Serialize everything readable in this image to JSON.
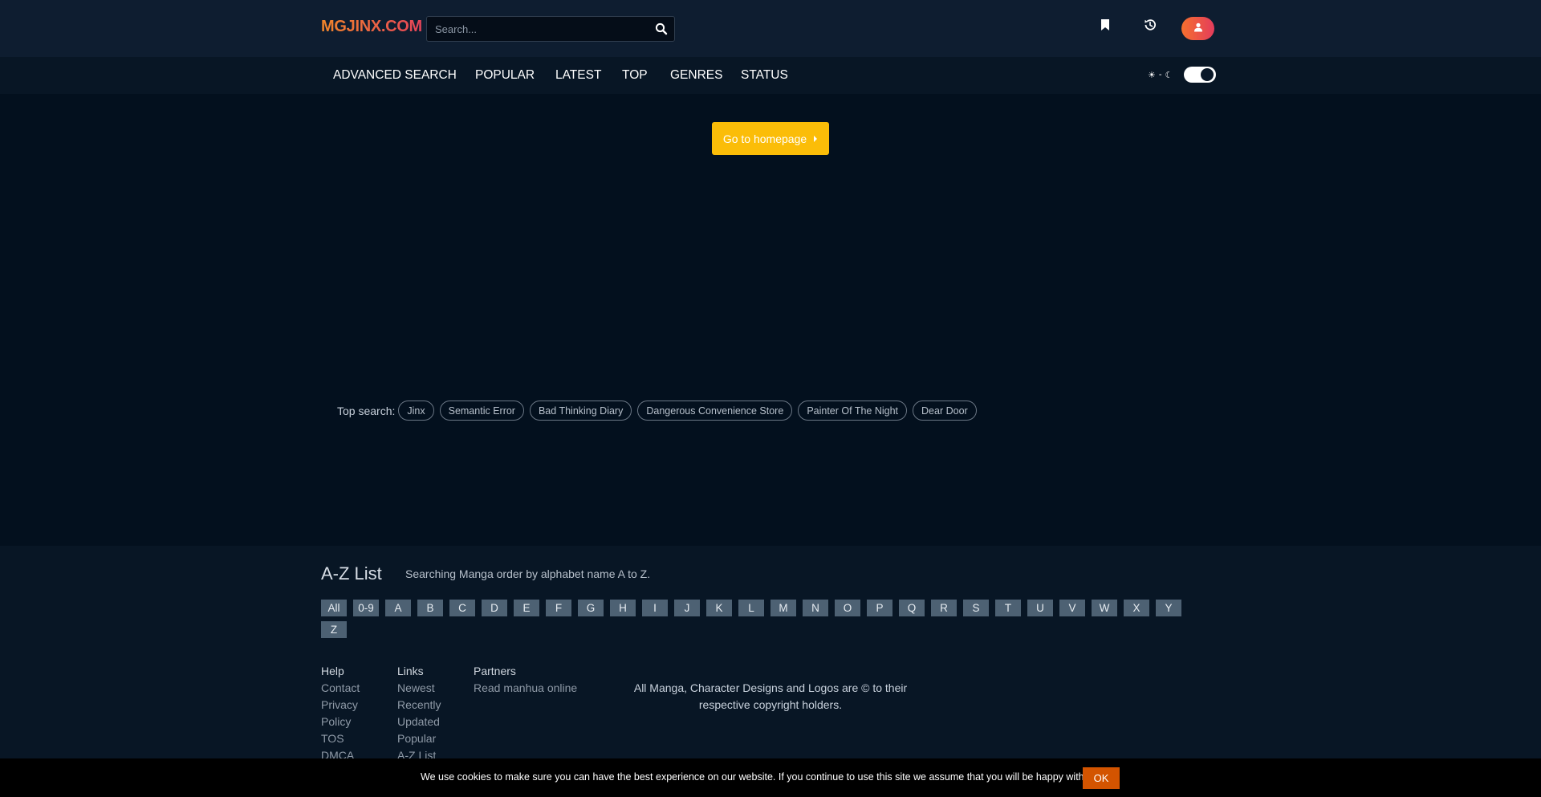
{
  "header": {
    "logo": "MGJINX.COM",
    "search_placeholder": "Search...",
    "icons": [
      "search-icon",
      "bookmark-icon",
      "history-icon",
      "user-icon"
    ]
  },
  "nav": {
    "items": [
      "ADVANCED SEARCH",
      "POPULAR",
      "LATEST",
      "TOP",
      "GENRES",
      "STATUS"
    ],
    "theme_light": "☀",
    "theme_sep": "-",
    "theme_dark": "☾"
  },
  "main": {
    "home_button": "Go to homepage",
    "top_search_label": "Top search:",
    "top_search": [
      "Jinx",
      "Semantic Error",
      "Bad Thinking Diary",
      "Dangerous Convenience Store",
      "Painter Of The Night",
      "Dear Door"
    ]
  },
  "footer": {
    "az_title": "A-Z List",
    "az_desc": "Searching Manga order by alphabet name A to Z.",
    "letters": [
      "All",
      "0-9",
      "A",
      "B",
      "C",
      "D",
      "E",
      "F",
      "G",
      "H",
      "I",
      "J",
      "K",
      "L",
      "M",
      "N",
      "O",
      "P",
      "Q",
      "R",
      "S",
      "T",
      "U",
      "V",
      "W",
      "X",
      "Y",
      "Z"
    ],
    "help": {
      "title": "Help",
      "links": [
        "Contact",
        "Privacy",
        "Policy",
        "TOS",
        "DMCA"
      ]
    },
    "links": {
      "title": "Links",
      "links": [
        "Newest",
        "Recently",
        "Updated",
        "Popular",
        "A-Z List"
      ]
    },
    "partners": {
      "title": "Partners",
      "links": [
        "Read manhua online"
      ]
    },
    "copyright": "All Manga, Character Designs and Logos are © to their respective copyright holders."
  },
  "cookie": {
    "text": "We use cookies to make sure you can have the best experience on our website. If you continue to use this site we assume that you will be happy with it.",
    "ok": "OK"
  },
  "colors": {
    "background": "#03101e",
    "accent_orange": "#f1862a",
    "home_button": "#fbbd08",
    "letter_bg": "#4d6173",
    "cookie_ok": "#d35400"
  }
}
